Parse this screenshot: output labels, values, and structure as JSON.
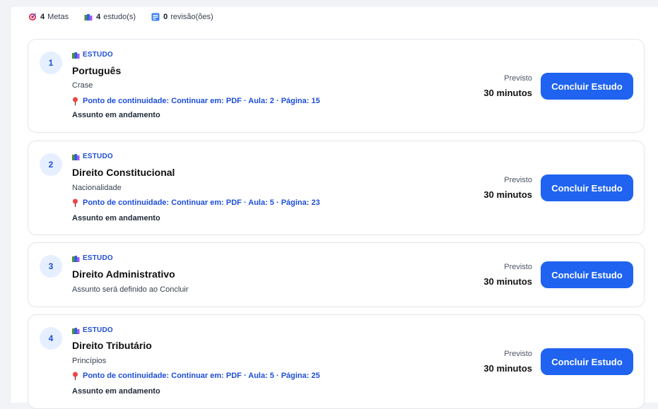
{
  "stats": {
    "metas": {
      "count": "4",
      "label": "Metas",
      "icon": "target-icon"
    },
    "estudos": {
      "count": "4",
      "label": "estudo(s)",
      "icon": "books-icon"
    },
    "revisoes": {
      "count": "0",
      "label": "revisão(ões)",
      "icon": "review-icon"
    }
  },
  "cards": [
    {
      "number": "1",
      "kind": "ESTUDO",
      "title": "Português",
      "subtitle": "Crase",
      "continuity": "Ponto de continuidade: Continuar em: PDF · Aula: 2 · Página: 15",
      "status": "Assunto em andamento",
      "previsto_label": "Previsto",
      "previsto_value": "30 minutos",
      "button": "Concluir Estudo"
    },
    {
      "number": "2",
      "kind": "ESTUDO",
      "title": "Direito Constitucional",
      "subtitle": "Nacionalidade",
      "continuity": "Ponto de continuidade: Continuar em: PDF · Aula: 5 · Página: 23",
      "status": "Assunto em andamento",
      "previsto_label": "Previsto",
      "previsto_value": "30 minutos",
      "button": "Concluir Estudo"
    },
    {
      "number": "3",
      "kind": "ESTUDO",
      "title": "Direito Administrativo",
      "subtitle": "Assunto será definido ao Concluir",
      "previsto_label": "Previsto",
      "previsto_value": "30 minutos",
      "button": "Concluir Estudo"
    },
    {
      "number": "4",
      "kind": "ESTUDO",
      "title": "Direito Tributário",
      "subtitle": "Princípios",
      "continuity": "Ponto de continuidade: Continuar em: PDF · Aula: 5 · Página: 25",
      "status": "Assunto em andamento",
      "previsto_label": "Previsto",
      "previsto_value": "30 minutos",
      "button": "Concluir Estudo"
    }
  ],
  "colors": {
    "accent": "#1f63f0",
    "link": "#1d4ed8",
    "badge_bg": "#e6efff"
  }
}
